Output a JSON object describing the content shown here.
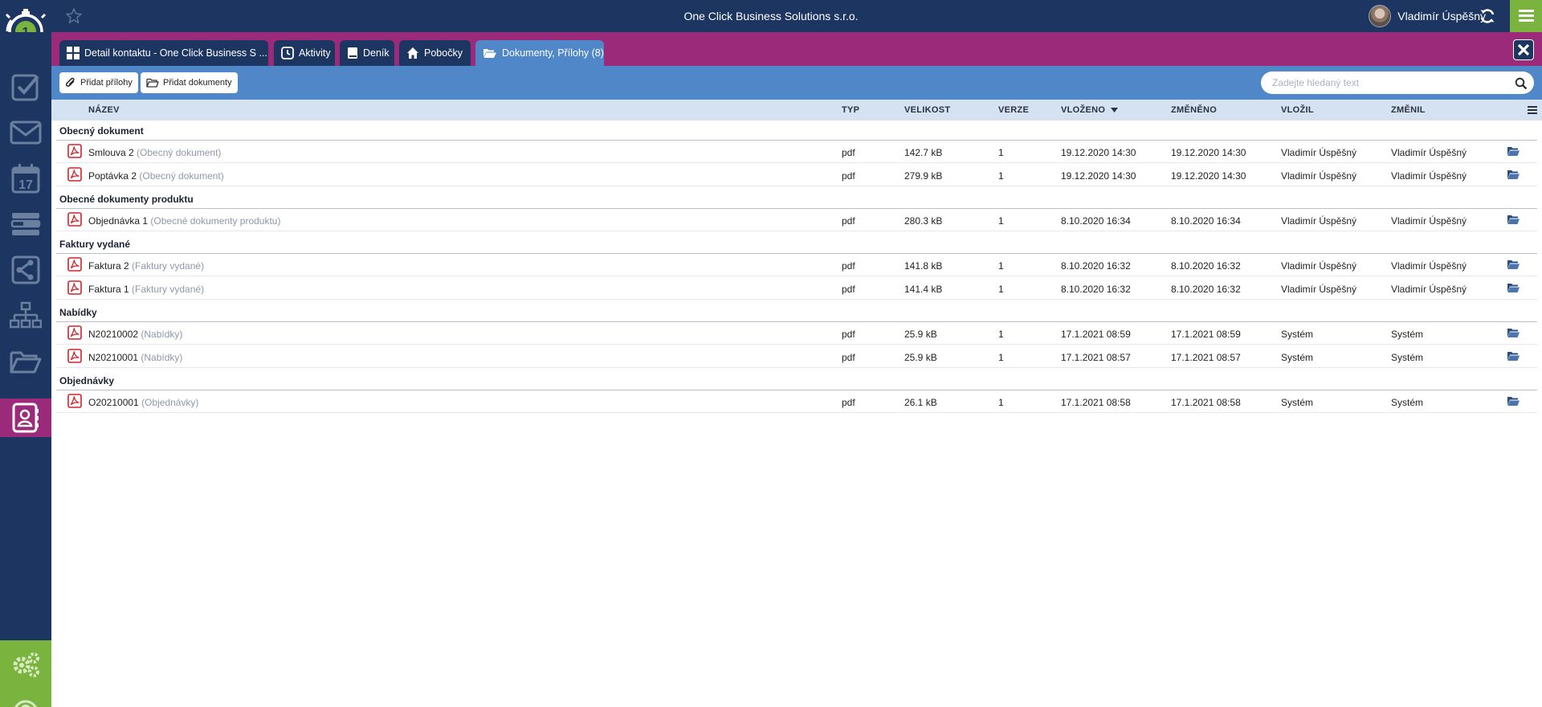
{
  "header": {
    "company": "One Click Business Solutions s.r.o.",
    "user_name": "Vladimír Úspěšný"
  },
  "tabs": [
    {
      "label": "Detail kontaktu - One Click Business S ...",
      "icon": "grid-icon",
      "active": false
    },
    {
      "label": "Aktivity",
      "icon": "clock-icon",
      "active": false
    },
    {
      "label": "Deník",
      "icon": "book-icon",
      "active": false
    },
    {
      "label": "Pobočky",
      "icon": "home-icon",
      "active": false
    },
    {
      "label": "Dokumenty, Přílohy (8)",
      "icon": "folder-open-icon",
      "active": true
    }
  ],
  "toolbar": {
    "add_attachments": "Přidat přílohy",
    "add_documents": "Přidat dokumenty",
    "search_placeholder": "Zadejte hledaný text"
  },
  "table": {
    "columns": {
      "name": "NÁZEV",
      "type": "TYP",
      "size": "VELIKOST",
      "version": "VERZE",
      "inserted": "VLOŽENO",
      "changed": "ZMĚNĚNO",
      "inserted_by": "VLOŽIL",
      "changed_by": "ZMĚNIL"
    },
    "sort": {
      "column": "VLOŽENO",
      "direction": "desc"
    },
    "groups": [
      {
        "title": "Obecný dokument",
        "rows": [
          {
            "name": "Smlouva 2",
            "category": "(Obecný dokument)",
            "type": "pdf",
            "size": "142.7 kB",
            "version": "1",
            "inserted": "19.12.2020 14:30",
            "changed": "19.12.2020 14:30",
            "inserted_by": "Vladimír Úspěšný",
            "changed_by": "Vladimír Úspěšný"
          },
          {
            "name": "Poptávka 2",
            "category": "(Obecný dokument)",
            "type": "pdf",
            "size": "279.9 kB",
            "version": "1",
            "inserted": "19.12.2020 14:30",
            "changed": "19.12.2020 14:30",
            "inserted_by": "Vladimír Úspěšný",
            "changed_by": "Vladimír Úspěšný"
          }
        ]
      },
      {
        "title": "Obecné dokumenty produktu",
        "rows": [
          {
            "name": "Objednávka 1",
            "category": "(Obecné dokumenty produktu)",
            "type": "pdf",
            "size": "280.3 kB",
            "version": "1",
            "inserted": "8.10.2020 16:34",
            "changed": "8.10.2020 16:34",
            "inserted_by": "Vladimír Úspěšný",
            "changed_by": "Vladimír Úspěšný"
          }
        ]
      },
      {
        "title": "Faktury vydané",
        "rows": [
          {
            "name": "Faktura 2",
            "category": "(Faktury vydané)",
            "type": "pdf",
            "size": "141.8 kB",
            "version": "1",
            "inserted": "8.10.2020 16:32",
            "changed": "8.10.2020 16:32",
            "inserted_by": "Vladimír Úspěšný",
            "changed_by": "Vladimír Úspěšný"
          },
          {
            "name": "Faktura 1",
            "category": "(Faktury vydané)",
            "type": "pdf",
            "size": "141.4 kB",
            "version": "1",
            "inserted": "8.10.2020 16:32",
            "changed": "8.10.2020 16:32",
            "inserted_by": "Vladimír Úspěšný",
            "changed_by": "Vladimír Úspěšný"
          }
        ]
      },
      {
        "title": "Nabídky",
        "rows": [
          {
            "name": "N20210002",
            "category": "(Nabídky)",
            "type": "pdf",
            "size": "25.9 kB",
            "version": "1",
            "inserted": "17.1.2021 08:59",
            "changed": "17.1.2021 08:59",
            "inserted_by": "Systém",
            "changed_by": "Systém"
          },
          {
            "name": "N20210001",
            "category": "(Nabídky)",
            "type": "pdf",
            "size": "25.9 kB",
            "version": "1",
            "inserted": "17.1.2021 08:57",
            "changed": "17.1.2021 08:57",
            "inserted_by": "Systém",
            "changed_by": "Systém"
          }
        ]
      },
      {
        "title": "Objednávky",
        "rows": [
          {
            "name": "O20210001",
            "category": "(Objednávky)",
            "type": "pdf",
            "size": "26.1 kB",
            "version": "1",
            "inserted": "17.1.2021 08:58",
            "changed": "17.1.2021 08:58",
            "inserted_by": "Systém",
            "changed_by": "Systém"
          }
        ]
      }
    ]
  },
  "sidebar": {
    "items": [
      {
        "name": "tasks",
        "icon": "checkbox-icon"
      },
      {
        "name": "mail",
        "icon": "envelope-icon"
      },
      {
        "name": "calendar",
        "icon": "calendar-icon",
        "text": "17"
      },
      {
        "name": "list",
        "icon": "list-icon"
      },
      {
        "name": "processes",
        "icon": "flow-icon"
      },
      {
        "name": "organization",
        "icon": "hierarchy-icon"
      },
      {
        "name": "documents",
        "icon": "folder-icon"
      },
      {
        "name": "contacts",
        "icon": "address-book-icon",
        "active": true
      }
    ],
    "bottom": [
      {
        "name": "settings",
        "icon": "gears-icon"
      },
      {
        "name": "help",
        "icon": "help-icon"
      }
    ]
  },
  "colors": {
    "navy": "#1d3661",
    "magenta": "#9c2a7b",
    "blue": "#4f87c8",
    "green": "#7ab33e",
    "header_bg": "#d4e2f1",
    "pdf_red": "#d1232a"
  }
}
